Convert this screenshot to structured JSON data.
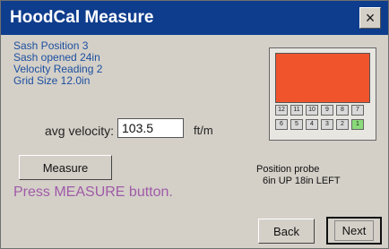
{
  "window": {
    "title": "HoodCal Measure",
    "close_glyph": "×",
    "title_color": "#0f3d8d"
  },
  "info": {
    "sash_position": "Sash Position 3",
    "sash_opened": "Sash opened 24in",
    "velocity_reading": "Velocity Reading 2",
    "grid_size": "Grid Size 12.0in"
  },
  "velocity": {
    "label": "avg velocity:",
    "value": "103.5",
    "unit": "ft/m"
  },
  "buttons": {
    "measure": "Measure",
    "back": "Back",
    "next": "Next"
  },
  "status": "Press MEASURE button.",
  "probe": {
    "line1": "Position probe",
    "line2": "6in UP 18in LEFT"
  },
  "grid": {
    "heat_color": "#f0542d",
    "rows": [
      [
        "12",
        "11",
        "10",
        "9",
        "8",
        "7"
      ],
      [
        "6",
        "5",
        "4",
        "3",
        "2",
        "1"
      ]
    ],
    "active_cell": "1"
  }
}
